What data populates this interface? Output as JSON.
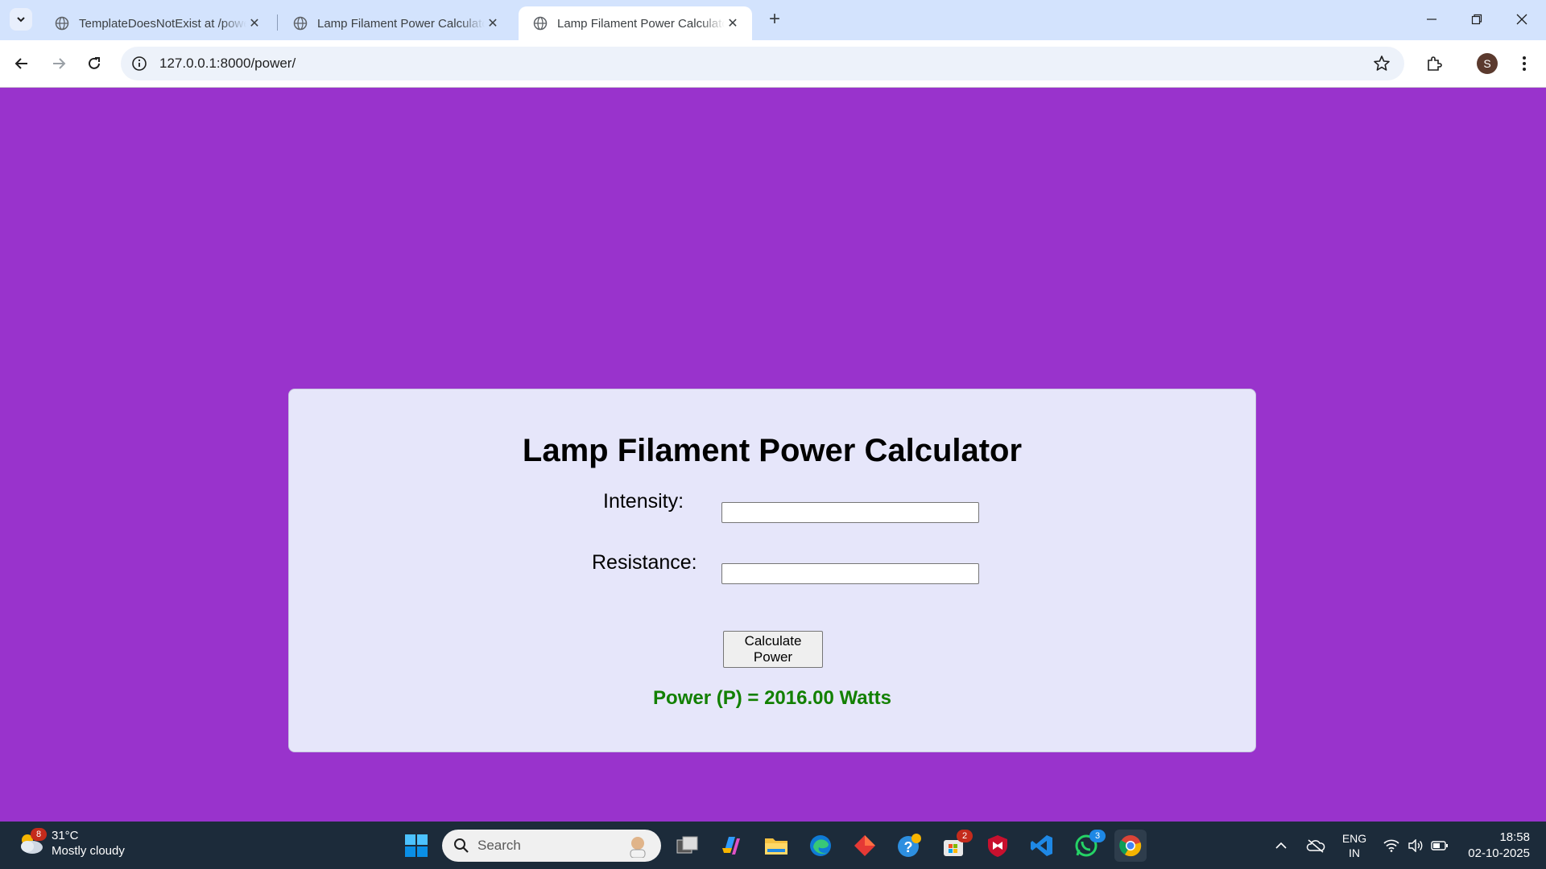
{
  "browser": {
    "tabs": [
      {
        "title": "TemplateDoesNotExist at /power/",
        "active": false
      },
      {
        "title": "Lamp Filament Power Calculator",
        "active": false
      },
      {
        "title": "Lamp Filament Power Calculator",
        "active": true
      }
    ],
    "url": "127.0.0.1:8000/power/",
    "profile_initial": "S"
  },
  "page": {
    "background_color": "#9933cc",
    "card_color": "#e6e6fa",
    "title": "Lamp Filament Power Calculator",
    "fields": [
      {
        "label": "Intensity:",
        "value": ""
      },
      {
        "label": "Resistance:",
        "value": ""
      }
    ],
    "button_label": "Calculate Power",
    "result": "Power (P) = 2016.00 Watts",
    "result_color": "#128000"
  },
  "taskbar": {
    "weather_temp": "31°C",
    "weather_desc": "Mostly cloudy",
    "weather_badge": "8",
    "search_label": "Search",
    "store_badge": "2",
    "whatsapp_badge": "3",
    "language": "ENG",
    "region": "IN",
    "time": "18:58",
    "date": "02-10-2025"
  }
}
